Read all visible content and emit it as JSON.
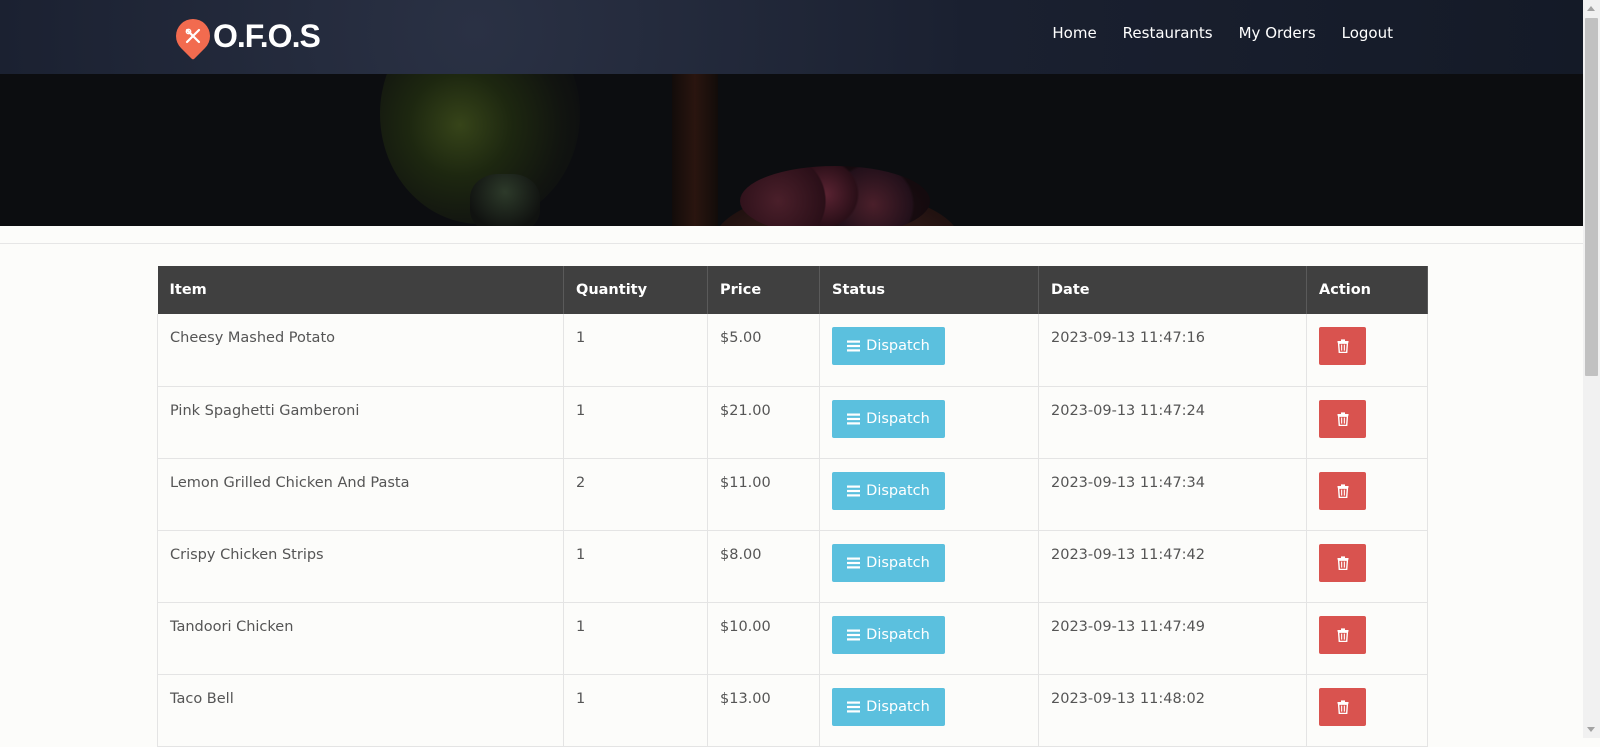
{
  "brand": {
    "name": "O.F.O.S",
    "logo_icon": "fork-knife-pin-icon",
    "accent": "#f26b4f"
  },
  "nav": {
    "items": [
      {
        "label": "Home"
      },
      {
        "label": "Restaurants"
      },
      {
        "label": "My Orders"
      },
      {
        "label": "Logout"
      }
    ]
  },
  "table": {
    "headers": [
      "Item",
      "Quantity",
      "Price",
      "Status",
      "Date",
      "Action"
    ],
    "status_button_label": "Dispatch",
    "status_button_icon": "menu-bars-icon",
    "action_icon": "trash-icon",
    "status_color": "#5bc0de",
    "action_color": "#d9534f",
    "rows": [
      {
        "item": "Cheesy Mashed Potato",
        "quantity": "1",
        "price": "$5.00",
        "date": "2023-09-13 11:47:16"
      },
      {
        "item": "Pink Spaghetti Gamberoni",
        "quantity": "1",
        "price": "$21.00",
        "date": "2023-09-13 11:47:24"
      },
      {
        "item": "Lemon Grilled Chicken And Pasta",
        "quantity": "2",
        "price": "$11.00",
        "date": "2023-09-13 11:47:34"
      },
      {
        "item": "Crispy Chicken Strips",
        "quantity": "1",
        "price": "$8.00",
        "date": "2023-09-13 11:47:42"
      },
      {
        "item": "Tandoori Chicken",
        "quantity": "1",
        "price": "$10.00",
        "date": "2023-09-13 11:47:49"
      },
      {
        "item": "Taco Bell",
        "quantity": "1",
        "price": "$13.00",
        "date": "2023-09-13 11:48:02"
      }
    ]
  }
}
